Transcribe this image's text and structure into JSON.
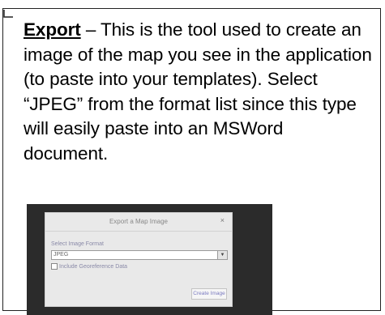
{
  "description": {
    "term": "Export",
    "rest": " – This is the tool used to create an image of the map you see in the application (to paste into your templates).  Select “JPEG” from the format list since this type will easily paste into an MSWord document."
  },
  "dialog": {
    "title": "Export a Map Image",
    "close_symbol": "×",
    "select_label": "Select Image Format",
    "select_value": "JPEG",
    "dropdown_symbol": "▼",
    "checkbox_label": "Include Georeference Data",
    "button_label": "Create Image"
  }
}
